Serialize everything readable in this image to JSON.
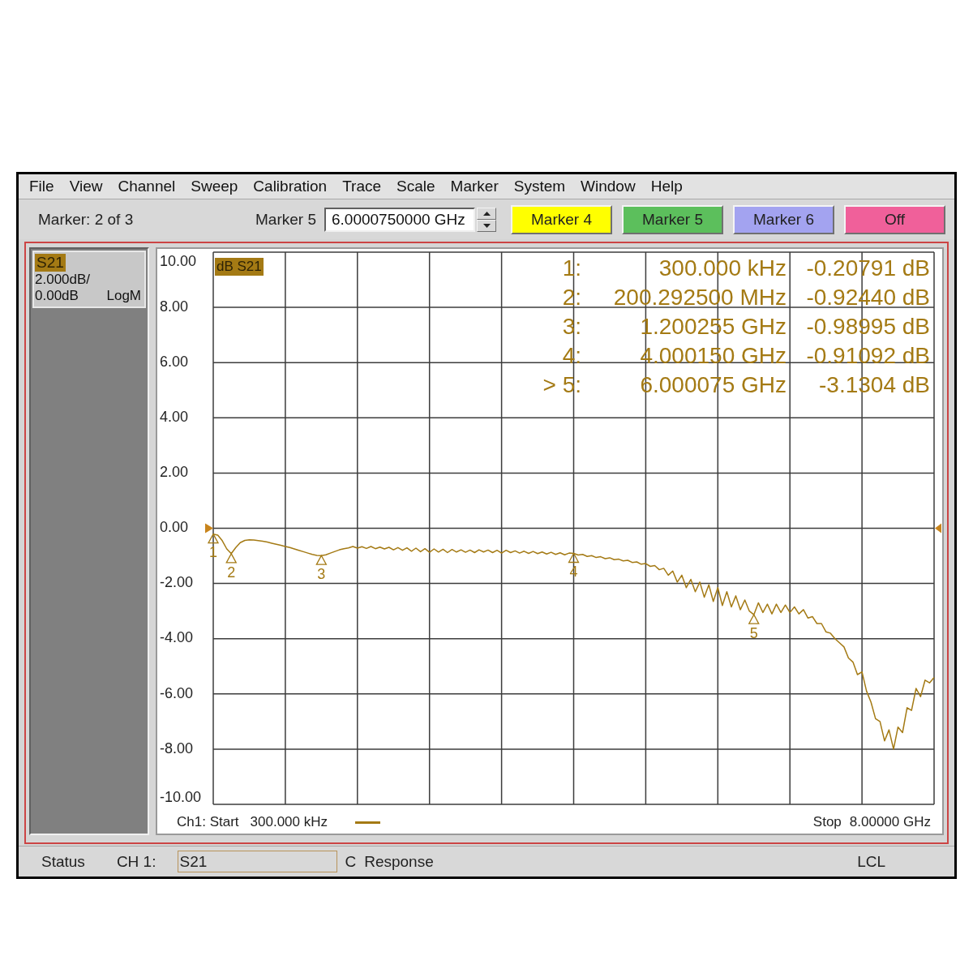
{
  "menu_bar": {
    "items": [
      "File",
      "View",
      "Channel",
      "Sweep",
      "Calibration",
      "Trace",
      "Scale",
      "Marker",
      "System",
      "Window",
      "Help"
    ]
  },
  "toolbar": {
    "marker_status": "Marker: 2 of 3",
    "marker_entry": {
      "label": "Marker 5",
      "value": "6.0000750000 GHz"
    },
    "marker_buttons": [
      {
        "label": "Marker 4",
        "color": "#ffff00"
      },
      {
        "label": "Marker 5",
        "color": "#5cbf5c"
      },
      {
        "label": "Marker 6",
        "color": "#a3a3f0"
      },
      {
        "label": "Off",
        "color": "#f0609a"
      }
    ]
  },
  "trace_panel": {
    "trace": "S21",
    "scale": "2.000dB/",
    "reference": "0.00dB",
    "format": "LogM"
  },
  "plot": {
    "chart_data": {
      "type": "line",
      "title": "dB S21",
      "grid": true,
      "categories": [
        "1",
        null,
        null,
        null,
        "2",
        null,
        null,
        null,
        null,
        null,
        null,
        null,
        null,
        null,
        null,
        null,
        null,
        null,
        null,
        null,
        null,
        null,
        null,
        null,
        "3",
        null,
        null,
        null,
        null,
        null,
        null,
        null,
        null,
        null,
        null,
        null,
        null,
        null,
        null,
        null,
        null,
        null,
        null,
        null,
        null,
        null,
        null,
        null,
        null,
        null,
        null,
        null,
        null,
        null,
        null,
        null,
        null,
        null,
        null,
        null,
        null,
        null,
        null,
        null,
        null,
        null,
        null,
        null,
        null,
        null,
        null,
        null,
        null,
        null,
        null,
        null,
        null,
        null,
        null,
        null,
        "4",
        null,
        null,
        null,
        null,
        null,
        null,
        null,
        null,
        null,
        null,
        null,
        null,
        null,
        null,
        null,
        null,
        null,
        null,
        null,
        null,
        null,
        null,
        null,
        null,
        null,
        null,
        null,
        null,
        null,
        null,
        null,
        null,
        null,
        null,
        null,
        null,
        null,
        null,
        null,
        "5",
        null,
        null,
        null,
        null,
        null,
        null,
        null,
        null,
        null,
        null,
        null,
        null,
        null,
        null,
        null,
        null,
        null,
        null,
        null,
        null,
        null,
        null,
        null,
        null,
        null,
        null,
        null,
        null,
        null,
        null,
        null,
        null,
        null,
        null,
        null,
        null,
        null,
        null,
        null,
        null
      ],
      "series": [
        {
          "color": "#a47a14",
          "values": [
            -0.21,
            -0.25,
            -0.45,
            -0.75,
            -0.92,
            -0.7,
            -0.52,
            -0.44,
            -0.42,
            -0.43,
            -0.45,
            -0.47,
            -0.5,
            -0.54,
            -0.58,
            -0.62,
            -0.66,
            -0.7,
            -0.75,
            -0.8,
            -0.85,
            -0.9,
            -0.95,
            -0.98,
            -0.99,
            -0.96,
            -0.9,
            -0.84,
            -0.78,
            -0.74,
            -0.71,
            -0.66,
            -0.72,
            -0.67,
            -0.73,
            -0.66,
            -0.74,
            -0.68,
            -0.75,
            -0.69,
            -0.78,
            -0.7,
            -0.8,
            -0.71,
            -0.83,
            -0.72,
            -0.85,
            -0.74,
            -0.87,
            -0.75,
            -0.86,
            -0.76,
            -0.88,
            -0.77,
            -0.86,
            -0.78,
            -0.87,
            -0.79,
            -0.88,
            -0.78,
            -0.86,
            -0.79,
            -0.88,
            -0.8,
            -0.9,
            -0.8,
            -0.88,
            -0.82,
            -0.9,
            -0.83,
            -0.91,
            -0.84,
            -0.92,
            -0.86,
            -0.93,
            -0.87,
            -0.95,
            -0.89,
            -0.96,
            -0.9,
            -0.91,
            -0.97,
            -0.95,
            -1.02,
            -0.99,
            -1.06,
            -1.03,
            -1.1,
            -1.07,
            -1.14,
            -1.12,
            -1.18,
            -1.16,
            -1.24,
            -1.22,
            -1.3,
            -1.28,
            -1.38,
            -1.35,
            -1.5,
            -1.45,
            -1.7,
            -1.55,
            -1.95,
            -1.7,
            -2.15,
            -1.85,
            -2.3,
            -1.95,
            -2.5,
            -2.05,
            -2.65,
            -2.15,
            -2.8,
            -2.3,
            -2.85,
            -2.45,
            -2.95,
            -2.6,
            -3.0,
            -3.13,
            -2.7,
            -3.05,
            -2.75,
            -3.1,
            -2.75,
            -3.05,
            -2.78,
            -3.05,
            -2.85,
            -3.1,
            -2.95,
            -3.25,
            -3.2,
            -3.45,
            -3.45,
            -3.75,
            -3.8,
            -4.0,
            -4.15,
            -4.3,
            -4.7,
            -4.85,
            -5.3,
            -5.2,
            -5.9,
            -6.3,
            -6.9,
            -7.0,
            -7.7,
            -7.3,
            -8.0,
            -7.2,
            -7.4,
            -6.5,
            -6.6,
            -5.8,
            -6.1,
            -5.5,
            -5.6,
            -5.4
          ]
        }
      ],
      "ylim": [
        -10,
        10
      ],
      "yticks": [
        {
          "value": 10,
          "label": "10.00"
        },
        {
          "value": 8,
          "label": "8.00"
        },
        {
          "value": 6,
          "label": "6.00"
        },
        {
          "value": 4,
          "label": "4.00"
        },
        {
          "value": 2,
          "label": "2.00"
        },
        {
          "value": 0,
          "label": "0.00"
        },
        {
          "value": -2,
          "label": "-2.00"
        },
        {
          "value": -4,
          "label": "-4.00"
        },
        {
          "value": -6,
          "label": "-6.00"
        },
        {
          "value": -8,
          "label": "-8.00"
        },
        {
          "value": -10,
          "label": "-10.00"
        }
      ]
    },
    "marker_readout": [
      {
        "index": "1:",
        "frequency": "300.000 kHz",
        "value": "-0.20791 dB"
      },
      {
        "index": "2:",
        "frequency": "200.292500 MHz",
        "value": "-0.92440 dB"
      },
      {
        "index": "3:",
        "frequency": "1.200255 GHz",
        "value": "-0.98995 dB"
      },
      {
        "index": "4:",
        "frequency": "4.000150 GHz",
        "value": "-0.91092 dB"
      },
      {
        "index": "> 5:",
        "frequency": "6.000075 GHz",
        "value": "-3.1304 dB"
      }
    ],
    "sweep": {
      "start_label": "Ch1: Start",
      "start_value": "300.000 kHz",
      "stop_label": "Stop",
      "stop_value": "8.00000 GHz"
    }
  },
  "status_bar": {
    "label": "Status",
    "channel": "CH 1:",
    "trace_field": "S21",
    "correction": "C",
    "mode": "Response",
    "remote": "LCL"
  }
}
